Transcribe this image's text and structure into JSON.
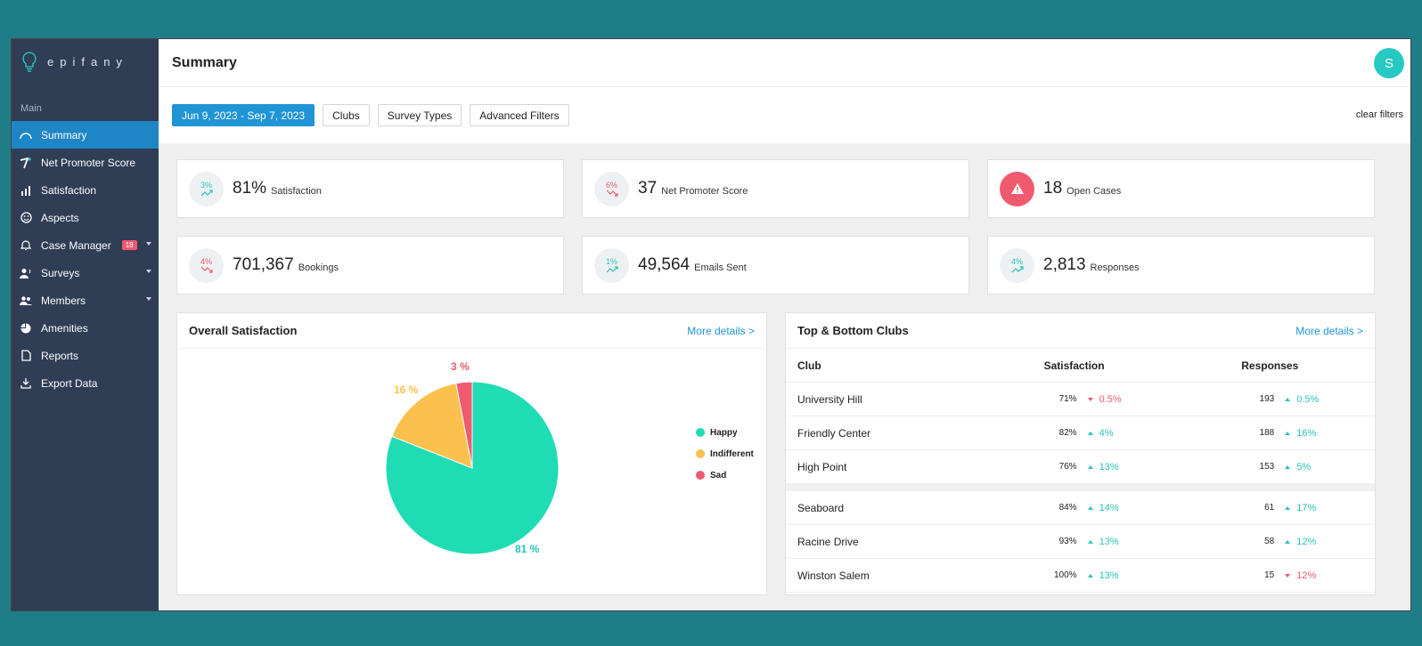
{
  "colors": {
    "accent": "#1f95d6",
    "up": "#28c4b8",
    "down": "#ef5a6f",
    "sidebar": "#2f3d55"
  },
  "brand": {
    "name": "epifany",
    "icon": "lightbulb-logo"
  },
  "sidebar": {
    "section": "Main",
    "items": [
      {
        "label": "Summary",
        "icon": "speedometer-icon",
        "active": true
      },
      {
        "label": "Net Promoter Score",
        "icon": "gauge-needle-icon"
      },
      {
        "label": "Satisfaction",
        "icon": "bar-chart-icon"
      },
      {
        "label": "Aspects",
        "icon": "smiley-icon"
      },
      {
        "label": "Case Manager",
        "icon": "bell-icon",
        "badge": "18",
        "expandable": true
      },
      {
        "label": "Surveys",
        "icon": "person-speech-icon",
        "expandable": true
      },
      {
        "label": "Members",
        "icon": "people-icon",
        "expandable": true
      },
      {
        "label": "Amenities",
        "icon": "pie-icon"
      },
      {
        "label": "Reports",
        "icon": "document-icon"
      },
      {
        "label": "Export Data",
        "icon": "download-icon"
      }
    ]
  },
  "header": {
    "title": "Summary",
    "avatar": "S"
  },
  "filters": {
    "date_range": "Jun 9, 2023 - Sep 7, 2023",
    "clubs": "Clubs",
    "survey_types": "Survey Types",
    "advanced": "Advanced Filters",
    "clear": "clear filters"
  },
  "stats": [
    {
      "trend_pct": "3%",
      "direction": "up",
      "value": "81%",
      "label": "Satisfaction"
    },
    {
      "trend_pct": "6%",
      "direction": "down",
      "value": "37",
      "label": "Net Promoter Score"
    },
    {
      "alert": true,
      "value": "18",
      "label": "Open Cases"
    },
    {
      "trend_pct": "4%",
      "direction": "down",
      "value": "701,367",
      "label": "Bookings"
    },
    {
      "trend_pct": "1%",
      "direction": "up",
      "value": "49,564",
      "label": "Emails Sent"
    },
    {
      "trend_pct": "4%",
      "direction": "up",
      "value": "2,813",
      "label": "Responses"
    }
  ],
  "satisfaction_panel": {
    "title": "Overall Satisfaction",
    "more": "More details >",
    "legend": [
      {
        "label": "Happy",
        "color": "#1fdcb4"
      },
      {
        "label": "Indifferent",
        "color": "#fcc14c"
      },
      {
        "label": "Sad",
        "color": "#ef5a6f"
      }
    ],
    "slice_labels": {
      "happy": "81 %",
      "indifferent": "16 %",
      "sad": "3 %"
    }
  },
  "chart_data": {
    "type": "pie",
    "categories": [
      "Happy",
      "Indifferent",
      "Sad"
    ],
    "values": [
      81,
      16,
      3
    ],
    "colors": [
      "#1fdcb4",
      "#fcc14c",
      "#ef5a6f"
    ],
    "title": "Overall Satisfaction",
    "legend": "right"
  },
  "clubs_panel": {
    "title": "Top & Bottom Clubs",
    "more": "More details >",
    "columns": {
      "club": "Club",
      "satisfaction": "Satisfaction",
      "responses": "Responses"
    },
    "top": [
      {
        "club": "University Hill",
        "sat": "71%",
        "sat_delta": "0.5%",
        "sat_dir": "down",
        "resp": "193",
        "resp_delta": "0.5%",
        "resp_dir": "up"
      },
      {
        "club": "Friendly Center",
        "sat": "82%",
        "sat_delta": "4%",
        "sat_dir": "up",
        "resp": "188",
        "resp_delta": "16%",
        "resp_dir": "up"
      },
      {
        "club": "High Point",
        "sat": "76%",
        "sat_delta": "13%",
        "sat_dir": "up",
        "resp": "153",
        "resp_delta": "5%",
        "resp_dir": "up"
      }
    ],
    "bottom": [
      {
        "club": "Seaboard",
        "sat": "84%",
        "sat_delta": "14%",
        "sat_dir": "up",
        "resp": "61",
        "resp_delta": "17%",
        "resp_dir": "up"
      },
      {
        "club": "Racine Drive",
        "sat": "93%",
        "sat_delta": "13%",
        "sat_dir": "up",
        "resp": "58",
        "resp_delta": "12%",
        "resp_dir": "up"
      },
      {
        "club": "Winston Salem",
        "sat": "100%",
        "sat_delta": "13%",
        "sat_dir": "up",
        "resp": "15",
        "resp_delta": "12%",
        "resp_dir": "down"
      }
    ]
  }
}
